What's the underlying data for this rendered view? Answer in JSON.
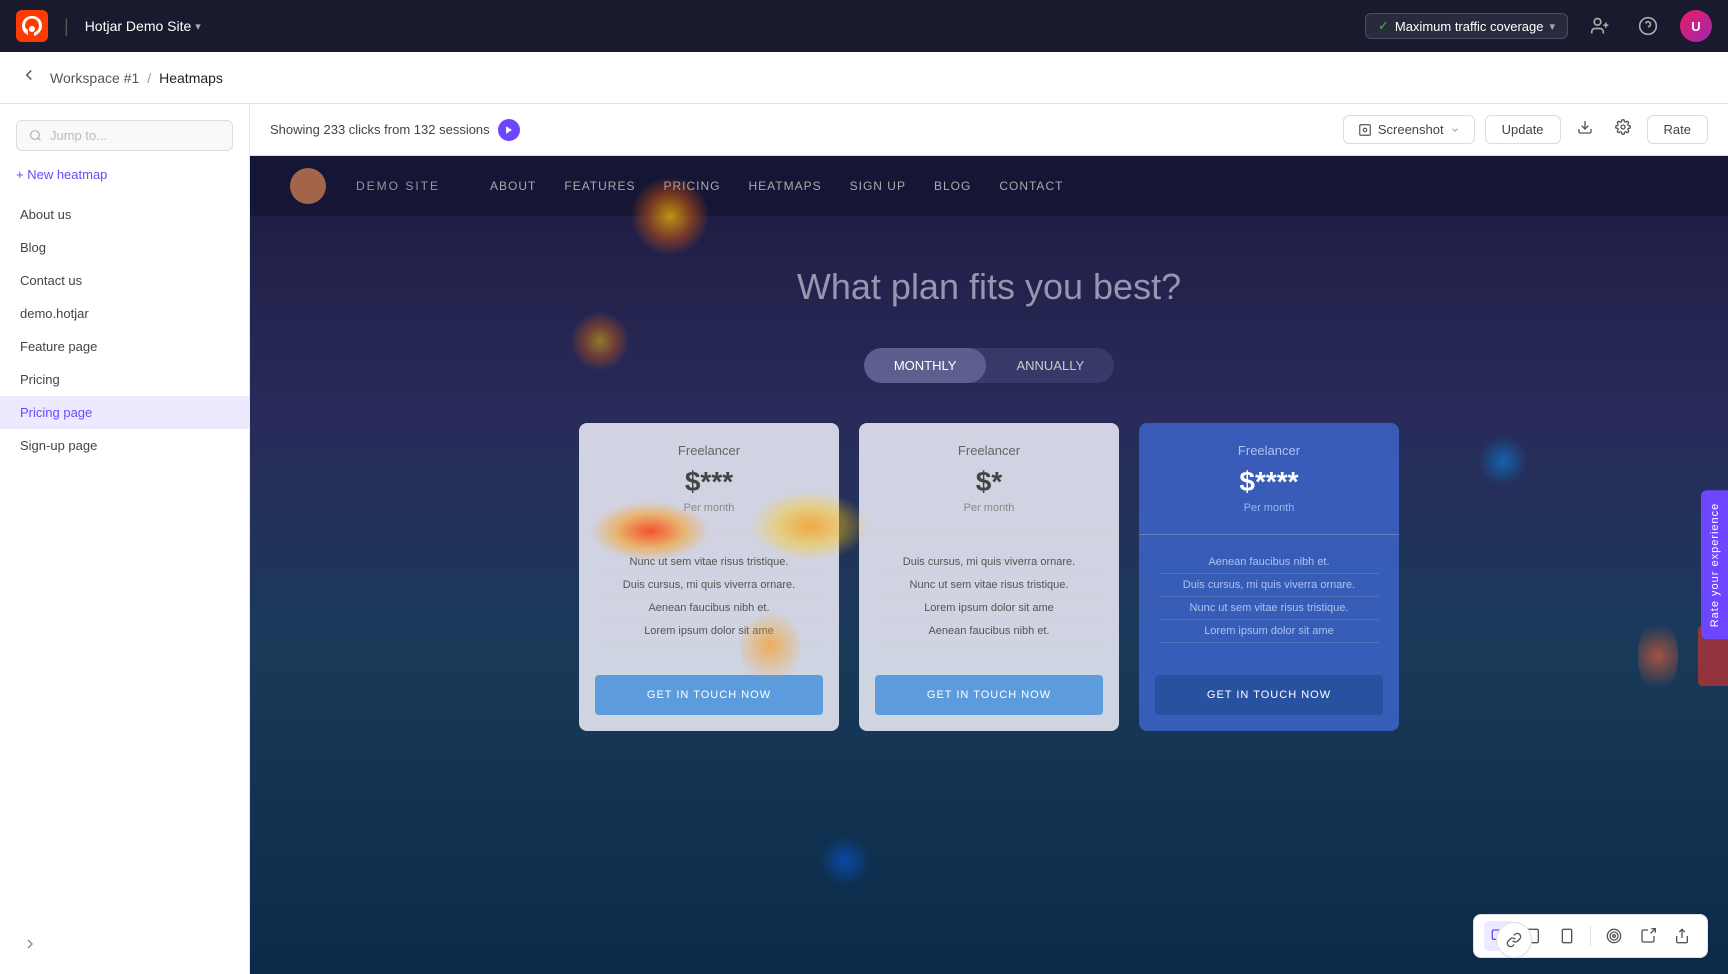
{
  "topNav": {
    "logoText": "hotjar",
    "siteName": "Hotjar Demo Site",
    "chevronLabel": "▾",
    "trafficLabel": "Maximum traffic coverage",
    "trafficChevron": "▾",
    "addUserIcon": "person-add",
    "helpIcon": "?",
    "avatarInitial": "U"
  },
  "subNav": {
    "backIcon": "←",
    "workspace": "Workspace #1",
    "separator": "/",
    "current": "Heatmaps"
  },
  "sidebar": {
    "searchPlaceholder": "Jump to...",
    "newHeatmapLabel": "+ New heatmap",
    "items": [
      {
        "label": "About us",
        "active": false
      },
      {
        "label": "Blog",
        "active": false
      },
      {
        "label": "Contact us",
        "active": false
      },
      {
        "label": "demo.hotjar",
        "active": false
      },
      {
        "label": "Feature page",
        "active": false
      },
      {
        "label": "Pricing",
        "active": false
      },
      {
        "label": "Pricing page",
        "active": true
      },
      {
        "label": "Sign-up page",
        "active": false
      }
    ],
    "collapseIcon": "→"
  },
  "toolbar": {
    "sessionInfo": "Showing 233 clicks from 132 sessions",
    "playIcon": "▶",
    "screenshotLabel": "Screenshot",
    "screenshotChevron": "▾",
    "updateLabel": "Update",
    "downloadIcon": "⬇",
    "settingsIcon": "⚙",
    "rateLabel": "Rate"
  },
  "demoSite": {
    "logoAlt": "demo-logo",
    "siteName": "DEMO SITE",
    "navLinks": [
      "ABOUT",
      "FEATURES",
      "PRICING",
      "HEATMAPS",
      "SIGN UP",
      "BLOG",
      "CONTACT"
    ],
    "heading": "What plan fits you best?",
    "toggleOptions": [
      "MONTHLY",
      "ANNUALLY"
    ],
    "cards": [
      {
        "tier": "Freelancer",
        "price": "$***",
        "period": "Per month",
        "features": [
          "Nunc ut sem vitae risus tristique.",
          "Duis cursus, mi quis viverra ornare.",
          "Aenean faucibus nibh et.",
          "Lorem ipsum dolor sit ame"
        ],
        "cta": "GET IN TOUCH NOW",
        "blue": false
      },
      {
        "tier": "Freelancer",
        "price": "$*",
        "period": "Per month",
        "features": [
          "Duis cursus, mi quis viverra ornare.",
          "Nunc ut sem vitae risus tristique.",
          "Lorem ipsum dolor sit ame",
          "Aenean faucibus nibh et."
        ],
        "cta": "GET IN TOUCH NOW",
        "blue": false
      },
      {
        "tier": "Freelancer",
        "price": "$****",
        "period": "Per month",
        "features": [
          "Aenean faucibus nibh et.",
          "Duis cursus, mi quis viverra ornare.",
          "Nunc ut sem vitae risus tristique.",
          "Lorem ipsum dolor sit ame"
        ],
        "cta": "GET IN TOUCH NOW",
        "blue": true
      }
    ]
  },
  "bottomToolbar": {
    "desktopIcon": "🖥",
    "tabletIcon": "⬜",
    "mobileIcon": "📱",
    "divider1": true,
    "targetIcon": "⊕",
    "clipIcon": "✂",
    "shareIcon": "⤢"
  },
  "sideFeedback": {
    "label": "Rate your experience"
  },
  "linkIcon": "🔗"
}
